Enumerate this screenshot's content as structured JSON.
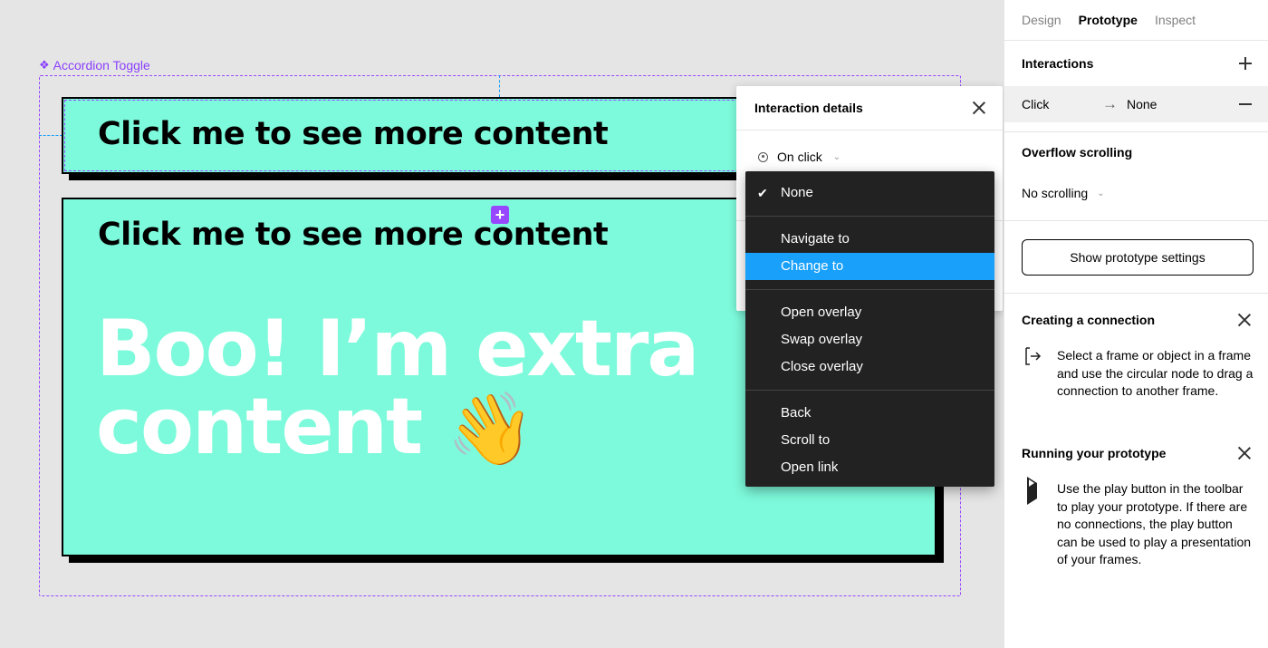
{
  "canvas": {
    "component_label": "Accordion Toggle",
    "card_title": "Click me to see more content",
    "extra_line1": "Boo! I’m extra",
    "extra_line2": "content",
    "wave_emoji": "👋",
    "accent_color": "#7dfadb",
    "selection_color": "#9747ff"
  },
  "interaction_popup": {
    "title": "Interaction details",
    "trigger": "On click"
  },
  "action_menu": {
    "selected": "None",
    "highlighted": "Change to",
    "groups": [
      [
        "None"
      ],
      [
        "Navigate to",
        "Change to"
      ],
      [
        "Open overlay",
        "Swap overlay",
        "Close overlay"
      ],
      [
        "Back",
        "Scroll to",
        "Open link"
      ]
    ]
  },
  "panel": {
    "tabs": [
      "Design",
      "Prototype",
      "Inspect"
    ],
    "active_tab": "Prototype",
    "interactions_title": "Interactions",
    "interaction": {
      "trigger": "Click",
      "action": "None"
    },
    "overflow_title": "Overflow scrolling",
    "overflow_value": "No scrolling",
    "settings_button": "Show prototype settings",
    "help": [
      {
        "title": "Creating a connection",
        "body": "Select a frame or object in a frame and use the circular node to drag a connection to another frame."
      },
      {
        "title": "Running your prototype",
        "body": "Use the play button in the toolbar to play your prototype. If there are no connections, the play button can be used to play a presentation of your frames."
      }
    ]
  }
}
